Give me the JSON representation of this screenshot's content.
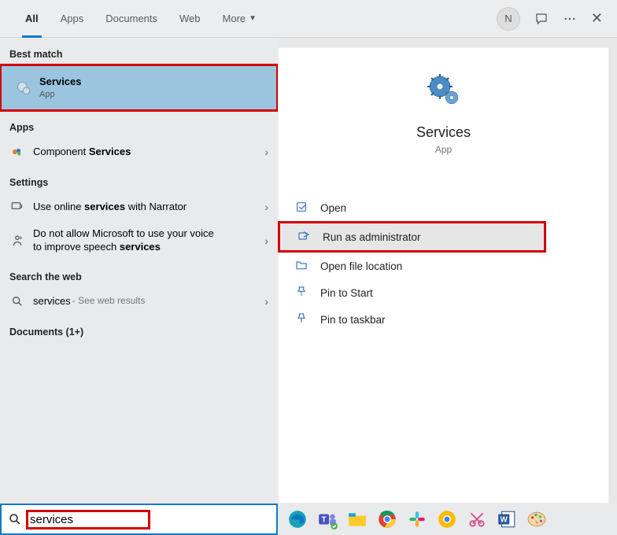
{
  "tabs": {
    "all": "All",
    "apps": "Apps",
    "documents": "Documents",
    "web": "Web",
    "more": "More"
  },
  "user_initial": "N",
  "sections": {
    "best_match": "Best match",
    "apps": "Apps",
    "settings": "Settings",
    "search_web": "Search the web",
    "documents": "Documents (1+)"
  },
  "results": {
    "best": {
      "title": "Services",
      "subtitle": "App"
    },
    "component_services_label": "Component Services",
    "narrator_label": "Use online services with Narrator",
    "speech_label": "Do not allow Microsoft to use your voice to improve speech services",
    "web_term": "services",
    "web_sub": " - See web results"
  },
  "right": {
    "title": "Services",
    "subtitle": "App",
    "actions": {
      "open": "Open",
      "run_admin": "Run as administrator",
      "open_loc": "Open file location",
      "pin_start": "Pin to Start",
      "pin_taskbar": "Pin to taskbar"
    }
  },
  "search_value": "services"
}
